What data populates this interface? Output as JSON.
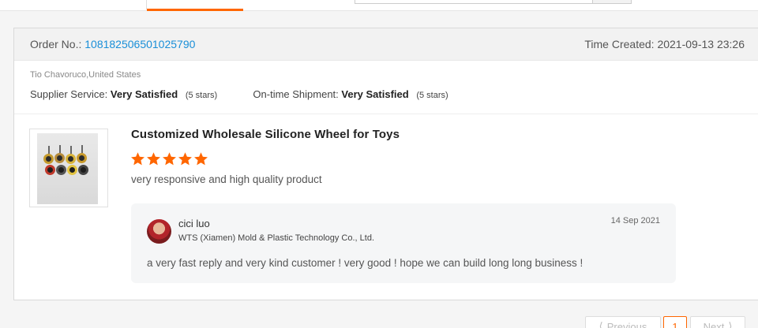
{
  "order": {
    "label": "Order No.:",
    "number": "108182506501025790",
    "time_label": "Time Created:",
    "time_value": "2021-09-13 23:26"
  },
  "buyer": {
    "name": "Tio Chavoruco,United States"
  },
  "ratings": {
    "supplier_label": "Supplier Service:",
    "supplier_value": "Very Satisfied",
    "supplier_stars": "(5 stars)",
    "shipment_label": "On-time Shipment:",
    "shipment_value": "Very Satisfied",
    "shipment_stars": "(5 stars)"
  },
  "product": {
    "title": "Customized Wholesale Silicone Wheel for Toys",
    "rating": 5,
    "review": "very responsive and high quality product"
  },
  "reply": {
    "name": "cici luo",
    "company": "WTS (Xiamen) Mold & Plastic Technology Co., Ltd.",
    "date": "14 Sep 2021",
    "text": "a very fast reply  and very kind customer !  very good ! hope we can build long long business !"
  },
  "pagination": {
    "prev": "Previous",
    "current": "1",
    "next": "Next"
  },
  "colors": {
    "accent": "#ff6600",
    "link": "#1a8fd8"
  }
}
